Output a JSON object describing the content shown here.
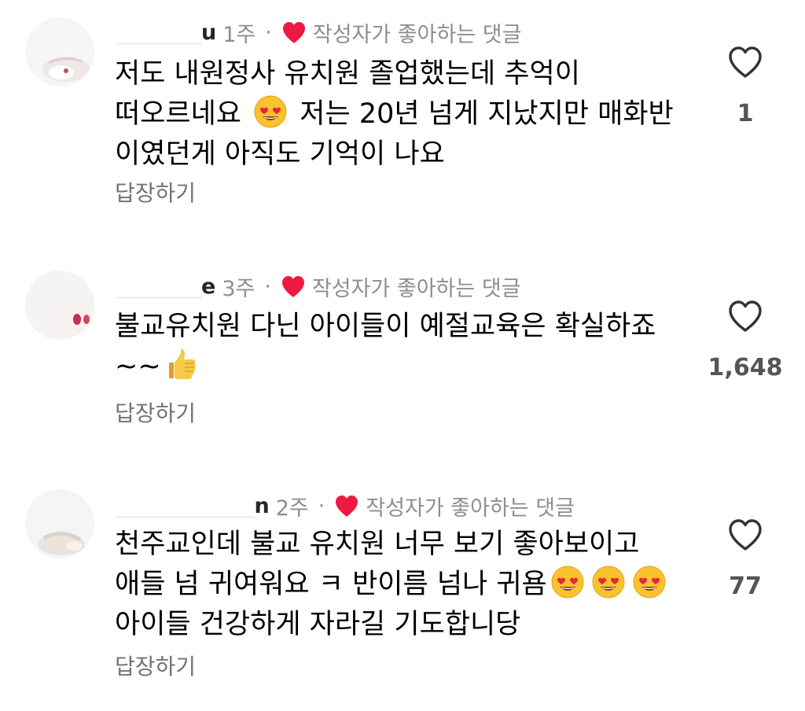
{
  "colors": {
    "heart": "#ed1943",
    "meta": "#8e8e8e",
    "reply": "#737373",
    "like_count": "#555555"
  },
  "comments": [
    {
      "username_visible": "u",
      "time": "1주",
      "separator": "·",
      "author_liked_label": "작성자가 좋아하는 댓글",
      "text_parts": [
        "저도 내원정사 유치원 졸업했는데 추억이 떠오르네요",
        "저는 20년 넘게 지났지만 매화반 이였던게 아직도 기억이 나요"
      ],
      "emojis": [
        "heart-eyes-emoji"
      ],
      "reply_label": "답장하기",
      "like_count": "1"
    },
    {
      "username_visible": "e",
      "time": "3주",
      "separator": "·",
      "author_liked_label": "작성자가 좋아하는 댓글",
      "text_parts": [
        "불교유치원 다닌 아이들이 예절교육은 확실하죠 ~~"
      ],
      "emojis": [
        "thumbs-up-emoji"
      ],
      "reply_label": "답장하기",
      "like_count": "1,648"
    },
    {
      "username_visible": "n",
      "time": "2주",
      "separator": "·",
      "author_liked_label": "작성자가 좋아하는 댓글",
      "text_parts": [
        "천주교인데 불교 유치원 너무 보기 좋아보이고 애들 넘 귀여워요 ㅋ 반이름 넘나 귀욤",
        "아이들 건강하게 자라길 기도합니당"
      ],
      "emojis": [
        "heart-eyes-emoji",
        "heart-eyes-emoji",
        "heart-eyes-emoji"
      ],
      "reply_label": "답장하기",
      "like_count": "77"
    }
  ]
}
